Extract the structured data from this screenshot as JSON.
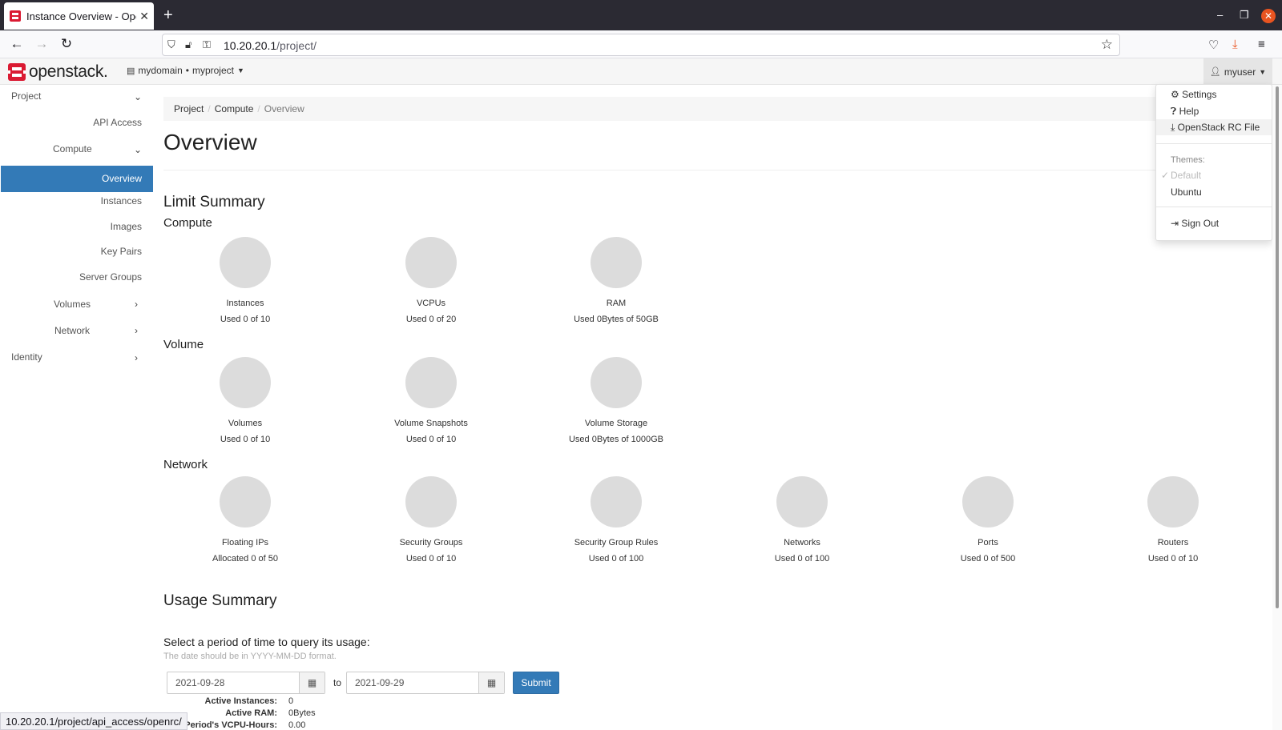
{
  "browser": {
    "tab_title": "Instance Overview - Openst",
    "url_host": "10.20.20.1",
    "url_path": "/project/",
    "status_url": "10.20.20.1/project/api_access/openrc/"
  },
  "header": {
    "logo_text": "openstack.",
    "domain": "mydomain",
    "separator": "•",
    "project": "myproject",
    "user": "myuser"
  },
  "sidebar": {
    "project": "Project",
    "api_access": "API Access",
    "compute": "Compute",
    "overview": "Overview",
    "instances": "Instances",
    "images": "Images",
    "key_pairs": "Key Pairs",
    "server_groups": "Server Groups",
    "volumes": "Volumes",
    "network": "Network",
    "identity": "Identity"
  },
  "breadcrumb": [
    "Project",
    "Compute",
    "Overview"
  ],
  "page_title": "Overview",
  "limit_summary": {
    "heading": "Limit Summary",
    "compute_heading": "Compute",
    "volume_heading": "Volume",
    "network_heading": "Network",
    "compute": [
      {
        "label": "Instances",
        "usage": "Used 0 of 10"
      },
      {
        "label": "VCPUs",
        "usage": "Used 0 of 20"
      },
      {
        "label": "RAM",
        "usage": "Used 0Bytes of 50GB"
      }
    ],
    "volume": [
      {
        "label": "Volumes",
        "usage": "Used 0 of 10"
      },
      {
        "label": "Volume Snapshots",
        "usage": "Used 0 of 10"
      },
      {
        "label": "Volume Storage",
        "usage": "Used 0Bytes of 1000GB"
      }
    ],
    "network": [
      {
        "label": "Floating IPs",
        "usage": "Allocated 0 of 50"
      },
      {
        "label": "Security Groups",
        "usage": "Used 0 of 10"
      },
      {
        "label": "Security Group Rules",
        "usage": "Used 0 of 100"
      },
      {
        "label": "Networks",
        "usage": "Used 0 of 100"
      },
      {
        "label": "Ports",
        "usage": "Used 0 of 500"
      },
      {
        "label": "Routers",
        "usage": "Used 0 of 10"
      }
    ]
  },
  "usage_summary": {
    "heading": "Usage Summary",
    "period_label": "Select a period of time to query its usage:",
    "period_help": "The date should be in YYYY-MM-DD format.",
    "start_date": "2021-09-28",
    "to_label": "to",
    "end_date": "2021-09-29",
    "submit": "Submit",
    "stats": [
      {
        "key": "Active Instances:",
        "value": "0"
      },
      {
        "key": "Active RAM:",
        "value": "0Bytes"
      },
      {
        "key": "This Period's VCPU-Hours:",
        "value": "0.00"
      }
    ]
  },
  "user_menu": {
    "settings": "Settings",
    "help": "Help",
    "openrc": "OpenStack RC File",
    "themes_label": "Themes:",
    "theme_default": "Default",
    "theme_ubuntu": "Ubuntu",
    "sign_out": "Sign Out"
  },
  "colors": {
    "accent": "#337ab7",
    "brand_red": "#da1a32",
    "pie_gray": "#dcdcdc"
  }
}
